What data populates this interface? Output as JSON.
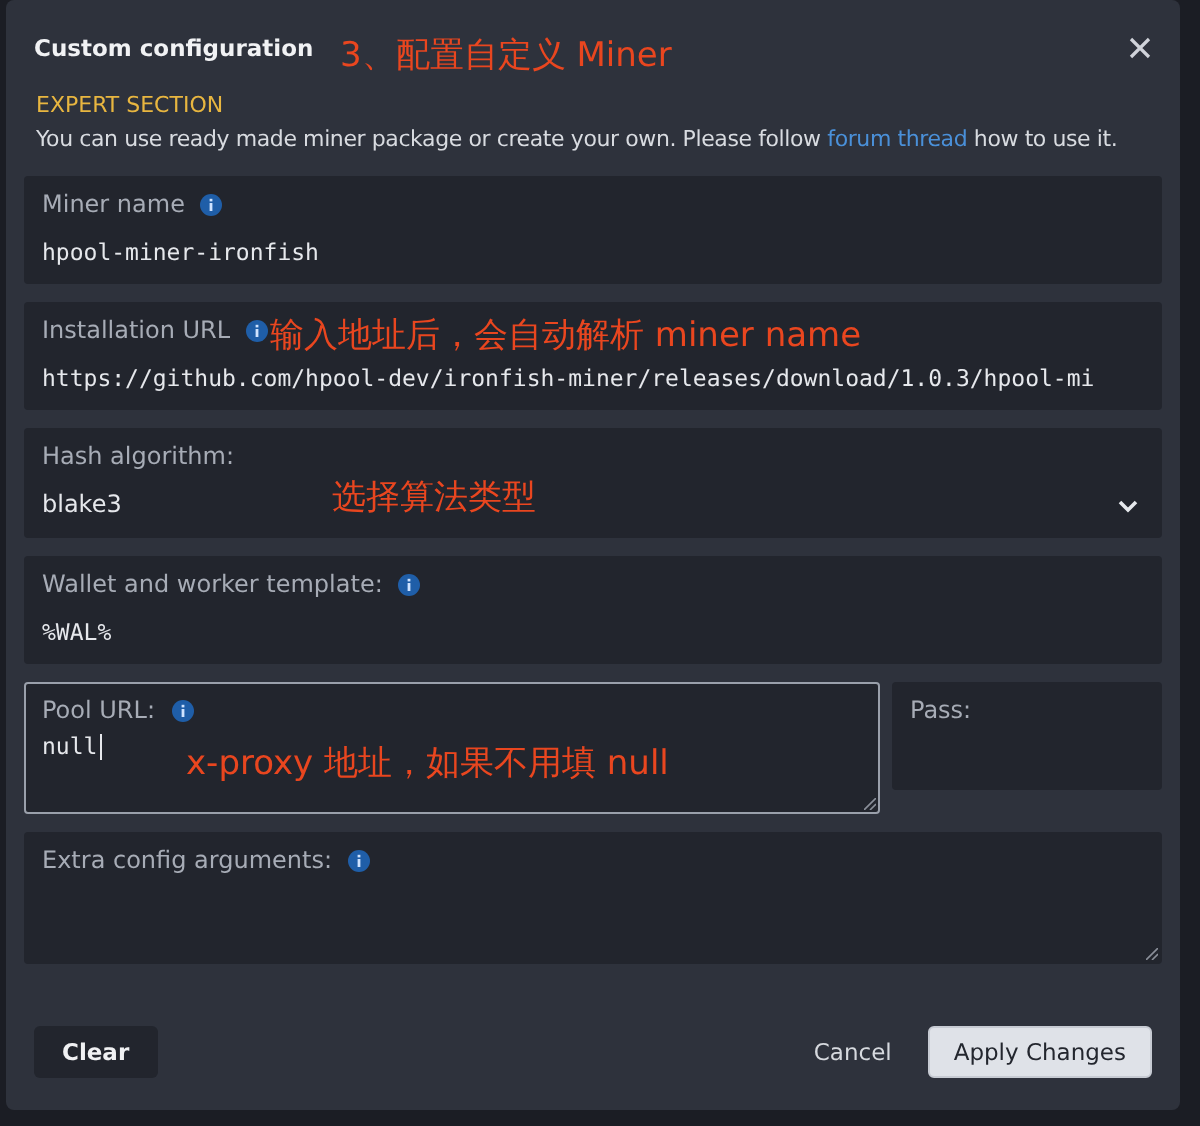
{
  "dialog": {
    "title": "Custom configuration",
    "annotation": "3、配置自定义 Miner",
    "section_heading": "EXPERT SECTION",
    "description": {
      "before": "You can use ready made miner package or create your own. Please follow",
      "link": "forum thread",
      "after": "how to use it."
    }
  },
  "fields": [
    {
      "kind": "input",
      "label": "Miner name",
      "info": true,
      "value": "hpool-miner-ironfish",
      "focused": false
    },
    {
      "kind": "input",
      "label": "Installation URL",
      "info": true,
      "value": "https://github.com/hpool-dev/ironfish-miner/releases/download/1.0.3/hpool-mi",
      "focused": false,
      "annotation": "输入地址后，会自动解析 miner name"
    },
    {
      "kind": "select",
      "label": "Hash algorithm:",
      "info": false,
      "value": "blake3",
      "focused": false,
      "annotation": "选择算法类型"
    },
    {
      "kind": "input",
      "label": "Wallet and worker template:",
      "info": true,
      "value": "%WAL%",
      "focused": false
    },
    {
      "kind": "pair",
      "items": [
        {
          "kind": "textarea",
          "label": "Pool URL:",
          "info": true,
          "value": "null",
          "focused": true,
          "annotation": "x-proxy 地址，如果不用填 null"
        },
        {
          "kind": "input",
          "label": "Pass:",
          "info": false,
          "focused": false
        }
      ]
    },
    {
      "kind": "textarea",
      "label": "Extra config arguments:",
      "info": true,
      "focused": false
    }
  ],
  "buttons": [
    {
      "kind": "secondary",
      "label": "Clear"
    },
    {
      "kind": "text",
      "label": "Cancel"
    },
    {
      "kind": "primary",
      "label": "Apply Changes"
    }
  ]
}
